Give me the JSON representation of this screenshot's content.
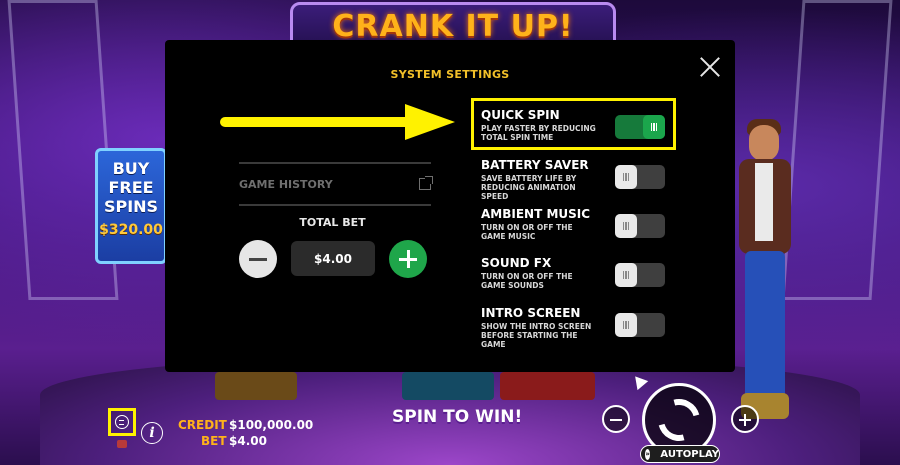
{
  "game": {
    "title": "CRANK IT UP!"
  },
  "buy_feature": {
    "lines": [
      "BUY",
      "FREE",
      "SPINS"
    ],
    "price": "$320.00"
  },
  "settings_panel": {
    "title": "SYSTEM SETTINGS",
    "game_history_label": "GAME HISTORY",
    "total_bet_label": "TOTAL BET",
    "total_bet_value": "$4.00",
    "options": [
      {
        "name": "QUICK SPIN",
        "description": "PLAY FASTER BY REDUCING TOTAL SPIN TIME",
        "enabled": true
      },
      {
        "name": "BATTERY SAVER",
        "description": "SAVE BATTERY LIFE BY REDUCING ANIMATION SPEED",
        "enabled": false
      },
      {
        "name": "AMBIENT MUSIC",
        "description": "TURN ON OR OFF THE GAME MUSIC",
        "enabled": false
      },
      {
        "name": "SOUND FX",
        "description": "TURN ON OR OFF THE GAME SOUNDS",
        "enabled": false
      },
      {
        "name": "INTRO SCREEN",
        "description": "SHOW THE INTRO SCREEN BEFORE STARTING THE GAME",
        "enabled": false
      }
    ]
  },
  "bottom_bar": {
    "credit_label": "CREDIT",
    "credit_value": "$100,000.00",
    "bet_label": "BET",
    "bet_value": "$4.00",
    "banner": "SPIN TO WIN!",
    "autoplay_label": "AUTOPLAY",
    "info_glyph": "i"
  },
  "colors": {
    "accent_yellow": "#fff200",
    "toggle_on": "#1ba64c",
    "gold_text": "#ffb21a"
  }
}
